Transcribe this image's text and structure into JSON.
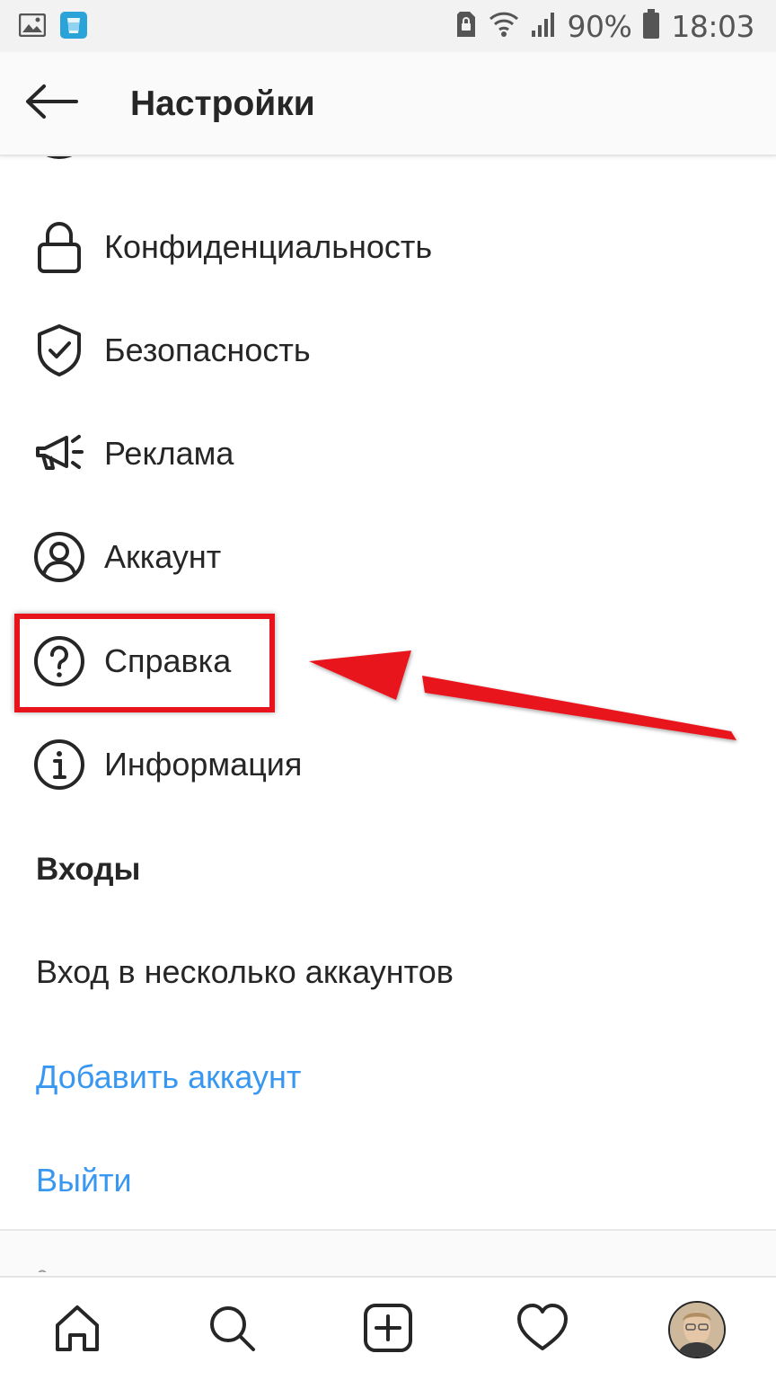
{
  "status_bar": {
    "battery_percent": "90%",
    "time": "18:03",
    "icons": [
      "gallery-icon",
      "app-notification-icon",
      "sim-lock-icon",
      "wifi-icon",
      "signal-icon",
      "battery-icon"
    ]
  },
  "header": {
    "title": "Настройки",
    "back_icon": "arrow-left-icon"
  },
  "settings": {
    "items": [
      {
        "label": "Конфиденциальность",
        "icon": "lock-icon"
      },
      {
        "label": "Безопасность",
        "icon": "shield-check-icon"
      },
      {
        "label": "Реклама",
        "icon": "megaphone-icon"
      },
      {
        "label": "Аккаунт",
        "icon": "user-circle-icon"
      },
      {
        "label": "Справка",
        "icon": "help-circle-icon"
      },
      {
        "label": "Информация",
        "icon": "info-circle-icon"
      }
    ]
  },
  "logins": {
    "section_title": "Входы",
    "multi_login": "Вход в несколько аккаунтов",
    "add_account": "Добавить аккаунт",
    "logout": "Выйти"
  },
  "bottom_nav": {
    "items": [
      "home-icon",
      "search-icon",
      "new-post-icon",
      "activity-heart-icon",
      "profile-avatar"
    ]
  },
  "colors": {
    "link": "#3897f0",
    "text": "#262626",
    "annotation": "#e8141b"
  }
}
